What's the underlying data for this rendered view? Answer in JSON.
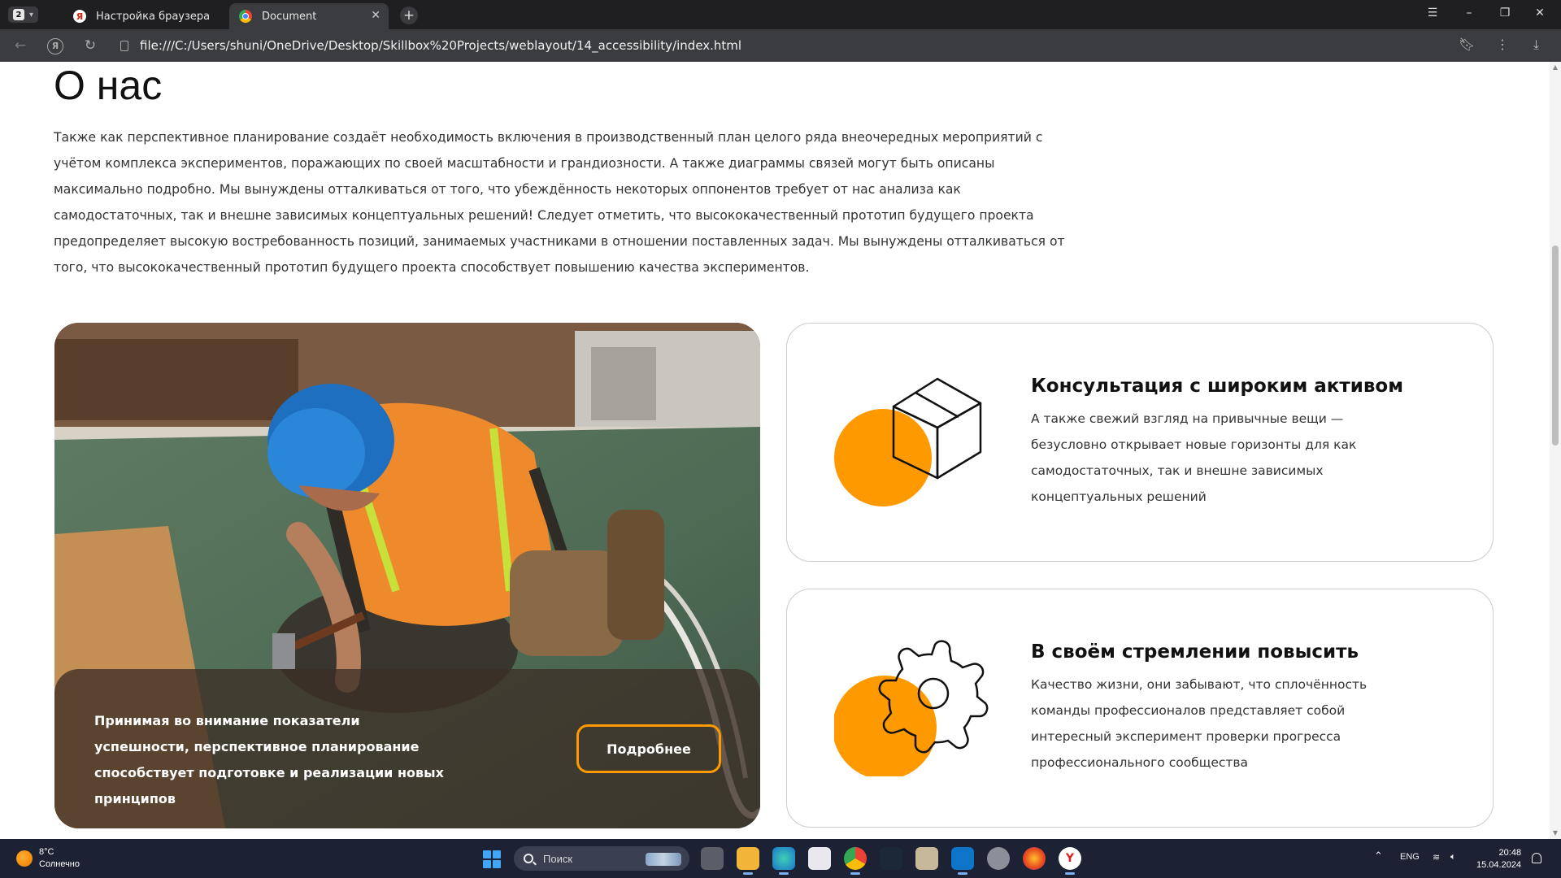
{
  "browser": {
    "tab_count": "2",
    "tabs": [
      {
        "label": "Настройка браузера",
        "favicon": "yandex-icon"
      },
      {
        "label": "Document",
        "favicon": "chrome-icon"
      }
    ],
    "url": "file:///C:/Users/shuni/OneDrive/Desktop/Skillbox%20Projects/weblayout/14_accessibility/index.html"
  },
  "page": {
    "title": "О нас",
    "intro": "Также как перспективное планирование создаёт необходимость включения в производственный план целого ряда внеочередных мероприятий с учётом комплекса экспериментов, поражающих по своей масштабности и грандиозности. А также диаграммы связей могут быть описаны максимально подробно. Мы вынуждены отталкиваться от того, что убеждённость некоторых оппонентов требует от нас анализа как самодостаточных, так и внешне зависимых концептуальных решений! Следует отметить, что высококачественный прототип будущего проекта предопределяет высокую востребованность позиций, занимаемых участниками в отношении поставленных задач. Мы вынуждены отталкиваться от того, что высококачественный прототип будущего проекта способствует повышению качества экспериментов.",
    "photo_card": {
      "caption": "Принимая во внимание показатели успешности, перспективное планирование способствует подготовке и реализации новых принципов",
      "button": "Подробнее"
    },
    "features": [
      {
        "title": "Консультация с широким активом",
        "text": "А также свежий взгляд на привычные вещи — безусловно открывает новые горизонты для как самодостаточных, так и внешне зависимых концептуальных решений",
        "icon": "box-icon"
      },
      {
        "title": "В своём стремлении повысить",
        "text": "Качество жизни, они забывают, что сплочённость команды профессионалов представляет собой интересный эксперимент проверки прогресса профессионального сообщества",
        "icon": "gear-icon"
      }
    ],
    "accent_color": "#ff9900"
  },
  "taskbar": {
    "weather_temp": "8°C",
    "weather_desc": "Солнечно",
    "search_placeholder": "Поиск",
    "lang": "ENG",
    "time": "20:48",
    "date": "15.04.2024"
  }
}
